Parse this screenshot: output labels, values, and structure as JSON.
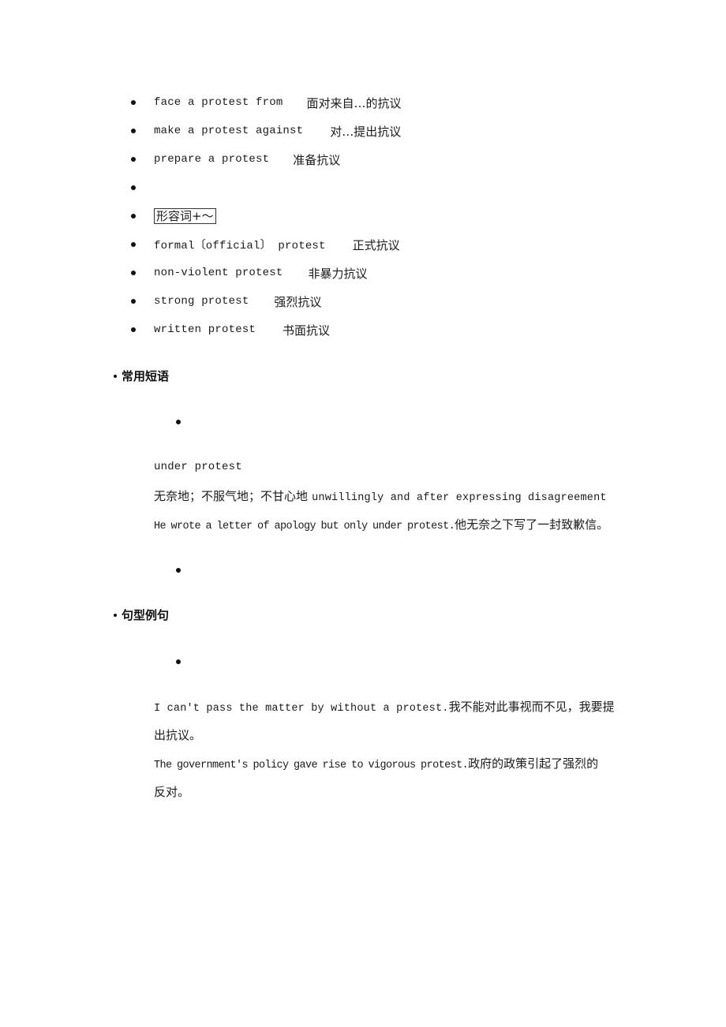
{
  "collocations": {
    "verb_items": [
      {
        "en": "face a protest from",
        "zh": "面对来自…的抗议"
      },
      {
        "en": "make a protest against",
        "zh": "对…提出抗议"
      },
      {
        "en": "prepare a protest",
        "zh": "准备抗议"
      }
    ],
    "adjective_heading": "形容词+～",
    "adjective_items": [
      {
        "en": "formal〔official〕 protest",
        "zh": "正式抗议"
      },
      {
        "en": "non-violent protest",
        "zh": "非暴力抗议"
      },
      {
        "en": "strong protest",
        "zh": "强烈抗议"
      },
      {
        "en": "written protest",
        "zh": "书面抗议"
      }
    ]
  },
  "phrases": {
    "heading": "常用短语",
    "items": [
      {
        "term": "under protest",
        "definition_zh": "无奈地；不服气地；不甘心地",
        "definition_en": "unwillingly and after expressing disagreement",
        "example_en": "He wrote a letter of apology but only under protest.",
        "example_zh": "他无奈之下写了一封致歉信。"
      }
    ]
  },
  "sentences": {
    "heading": "句型例句",
    "items": [
      {
        "en": "I can't pass the matter by without a protest.",
        "zh_line1": "我不能对此事视而不见，我要提",
        "zh_line2": "出抗议。"
      },
      {
        "en": "The government's policy gave rise to vigorous protest.",
        "zh_line1": "政府的政策引起了强烈的",
        "zh_line2": "反对。"
      }
    ]
  }
}
